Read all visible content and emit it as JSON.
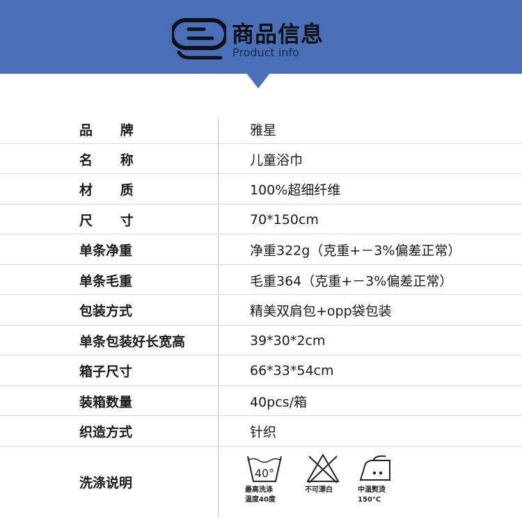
{
  "header": {
    "title": "商品信息",
    "subtitle": "Product info",
    "color": "#4a6fb9"
  },
  "rows": [
    {
      "label": "品      牌",
      "value": "雅星"
    },
    {
      "label": "名      称",
      "value": "儿童浴巾"
    },
    {
      "label": "材      质",
      "value": "100%超细纤维"
    },
    {
      "label": "尺      寸",
      "value": "70*150cm"
    },
    {
      "label": "单条净重",
      "value": "净重322g（克重+－3%偏差正常）"
    },
    {
      "label": "单条毛重",
      "value": "毛重364（克重+－3%偏差正常）"
    },
    {
      "label": "包装方式",
      "value": "精美双肩包+opp袋包装"
    },
    {
      "label": "单条包装好长宽高",
      "value": "39*30*2cm"
    },
    {
      "label": "箱子尺寸",
      "value": "66*33*54cm"
    },
    {
      "label": "装箱数量",
      "value": "40pcs/箱"
    },
    {
      "label": "织造方式",
      "value": "针织"
    },
    {
      "label": "洗涤说明",
      "value": ""
    }
  ],
  "care": [
    {
      "icon": "wash-40-icon",
      "symbol_text": "40°",
      "caption": "最高洗涤\n温度40度"
    },
    {
      "icon": "no-bleach-icon",
      "symbol_text": "",
      "caption": "不可漂白"
    },
    {
      "icon": "iron-medium-icon",
      "symbol_text": "",
      "caption": "中温熨烫\n150°C"
    }
  ]
}
